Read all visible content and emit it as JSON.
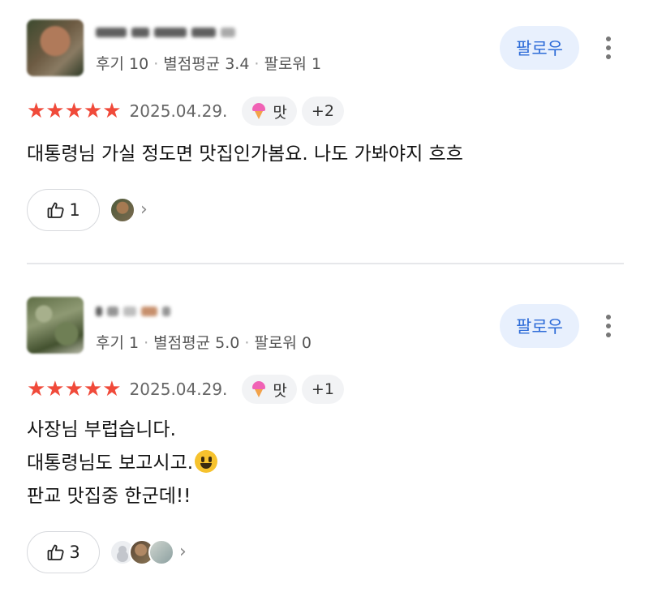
{
  "reviews": [
    {
      "stats": {
        "reviews": "후기 10",
        "avg": "별점평균 3.4",
        "followers": "팔로워 1"
      },
      "follow_label": "팔로우",
      "stars": "★★★★★",
      "date": "2025.04.29.",
      "tag_label": "맛",
      "extra_tags": "+2",
      "text_lines": [
        "대통령님 가실 정도면 맛집인가봄요. 나도 가봐야지 흐흐"
      ],
      "likes": "1"
    },
    {
      "stats": {
        "reviews": "후기 1",
        "avg": "별점평균 5.0",
        "followers": "팔로워 0"
      },
      "follow_label": "팔로우",
      "stars": "★★★★★",
      "date": "2025.04.29.",
      "tag_label": "맛",
      "extra_tags": "+1",
      "text_lines": [
        "사장님 부럽습니다.",
        "대통령님도 보고시고.",
        "판교 맛집중 한군데!!"
      ],
      "likes": "3"
    }
  ],
  "icons": {
    "like": "thumbs-up-icon",
    "more": "more-vertical-icon",
    "tag": "ice-cream-icon",
    "emoji": "smiling-face-emoji",
    "chevron": "chevron-right-icon"
  },
  "colors": {
    "star": "#f04a3a",
    "follow_bg": "#e8f0fd",
    "follow_text": "#2d6bd8"
  }
}
